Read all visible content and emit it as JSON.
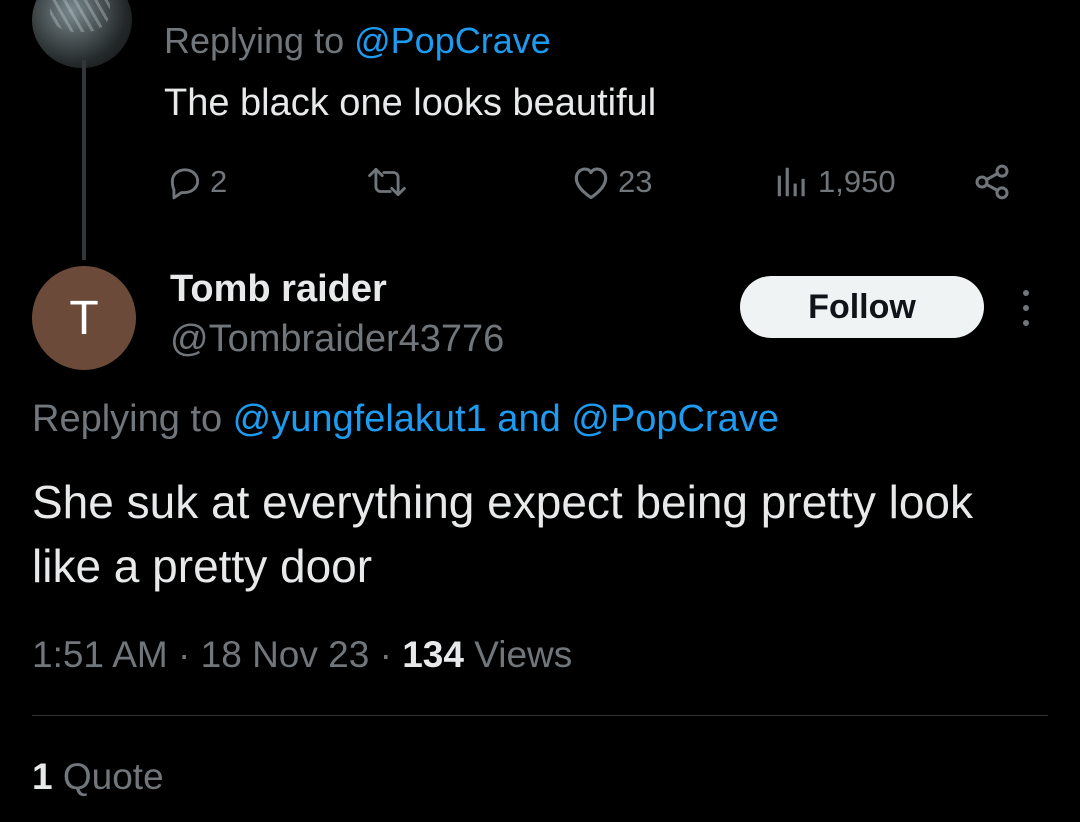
{
  "parent": {
    "reply_prefix": "Replying to ",
    "reply_mention": "@PopCrave",
    "text": "The black one looks beautiful",
    "actions": {
      "reply_icon": "reply-icon",
      "reply_count": "2",
      "retweet_icon": "retweet-icon",
      "retweet_count": "",
      "like_icon": "heart-icon",
      "like_count": "23",
      "views_icon": "views-icon",
      "views_count": "1,950",
      "share_icon": "share-icon"
    }
  },
  "tweet": {
    "avatar_letter": "T",
    "avatar_color": "#6b4a3a",
    "author_name": "Tomb raider",
    "author_handle": "@Tombraider43776",
    "follow_label": "Follow",
    "reply_prefix": "Replying to ",
    "reply_mention_1": "@yungfelakut1",
    "reply_and": " and ",
    "reply_mention_2": "@PopCrave",
    "text": "She suk at everything expect being pretty look like a pretty door",
    "time": "1:51 AM",
    "date": "18 Nov 23",
    "sep": " · ",
    "views_count": "134",
    "views_label": " Views",
    "quote_count": "1",
    "quote_label": " Quote"
  },
  "colors": {
    "background": "#000000",
    "text_primary": "#e7e9ea",
    "text_secondary": "#71767b",
    "link": "#1d9bf0",
    "divider": "#2f3336"
  }
}
